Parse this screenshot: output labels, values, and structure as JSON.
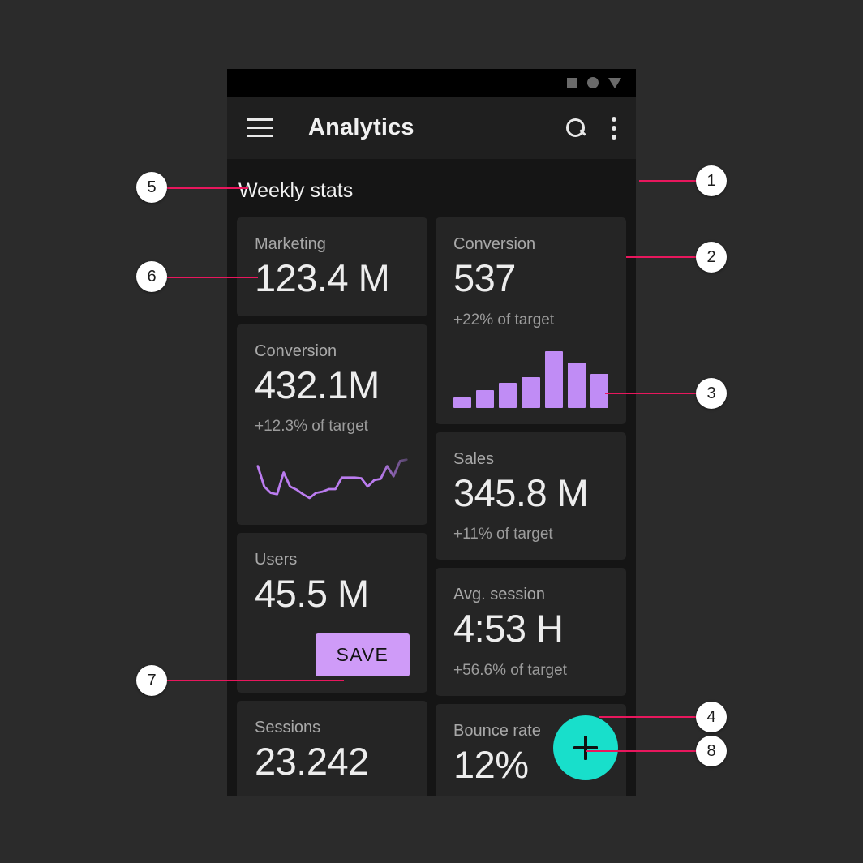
{
  "status_bar": {
    "indicators": [
      "square-icon",
      "circle-icon",
      "triangle-down-icon"
    ]
  },
  "app_bar": {
    "menu_icon": "hamburger-menu-icon",
    "title": "Analytics",
    "search_icon": "search-icon",
    "overflow_icon": "more-vertical-icon"
  },
  "content": {
    "section_title": "Weekly stats",
    "left_column": [
      {
        "label": "Marketing",
        "value": "123.4 M",
        "sub": "",
        "chart": null
      },
      {
        "label": "Conversion",
        "value": "432.1M",
        "sub": "+12.3% of target",
        "chart": "line"
      },
      {
        "label": "Users",
        "value": "45.5 M",
        "sub": "",
        "chart": null,
        "button": "SAVE"
      },
      {
        "label": "Sessions",
        "value": "23.242",
        "sub": "",
        "chart": null
      }
    ],
    "right_column": [
      {
        "label": "Conversion",
        "value": "537",
        "sub": "+22% of target",
        "chart": "bar"
      },
      {
        "label": "Sales",
        "value": "345.8 M",
        "sub": "+11% of target",
        "chart": null
      },
      {
        "label": "Avg. session",
        "value": "4:53 H",
        "sub": "+56.6% of target",
        "chart": null
      },
      {
        "label": "Bounce rate",
        "value": "12%",
        "sub": "",
        "chart": null
      }
    ]
  },
  "fab": {
    "icon": "plus-icon",
    "color": "#18DFCB"
  },
  "callouts": [
    {
      "number": "1"
    },
    {
      "number": "2"
    },
    {
      "number": "3"
    },
    {
      "number": "4"
    },
    {
      "number": "5"
    },
    {
      "number": "6"
    },
    {
      "number": "7"
    },
    {
      "number": "8"
    }
  ],
  "colors": {
    "page_background": "#2b2b2b",
    "screen_background": "#151515",
    "card_background": "#252525",
    "app_bar": "#1f1f1f",
    "accent_purple": "#c08cf5",
    "accent_teal": "#18DFCB",
    "callout_line": "#e8175d",
    "text_primary": "#ededed",
    "text_secondary": "#a8a8a8"
  },
  "chart_data": [
    {
      "type": "bar",
      "title": "Conversion",
      "categories": [
        "1",
        "2",
        "3",
        "4",
        "5",
        "6",
        "7"
      ],
      "values": [
        13,
        22,
        31,
        38,
        70,
        56,
        42
      ],
      "xlabel": "",
      "ylabel": "",
      "ylim": [
        0,
        75
      ],
      "grid": false,
      "legend": "none",
      "color": "#c08cf5"
    },
    {
      "type": "line",
      "title": "Conversion",
      "x": [
        0,
        1,
        2,
        3,
        4,
        5,
        6,
        7,
        8,
        9,
        10,
        11,
        12,
        13,
        14,
        15,
        16,
        17,
        18,
        19,
        20,
        21,
        22,
        23
      ],
      "values": [
        62,
        30,
        20,
        18,
        52,
        30,
        25,
        18,
        12,
        20,
        22,
        26,
        26,
        44,
        44,
        44,
        43,
        30,
        40,
        42,
        62,
        46,
        70,
        72
      ],
      "xlabel": "",
      "ylabel": "",
      "ylim": [
        0,
        80
      ],
      "grid": false,
      "legend": "none",
      "color": "#bb7cf0"
    }
  ]
}
